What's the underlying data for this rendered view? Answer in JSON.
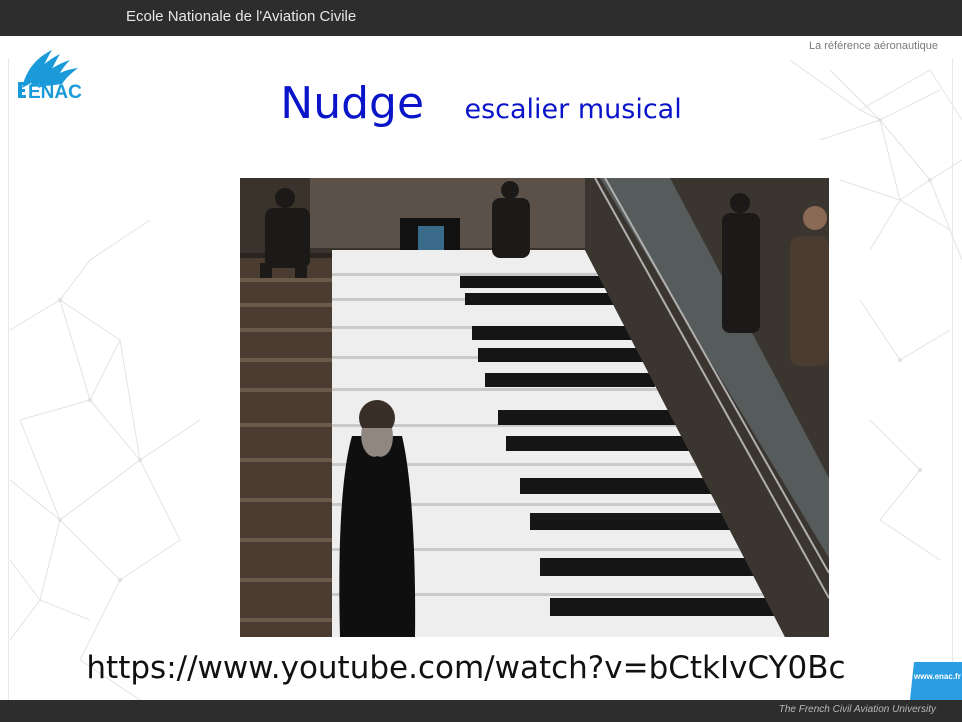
{
  "header": {
    "title": "Ecole Nationale de l'Aviation Civile",
    "tagline": "La référence aéronautique"
  },
  "logo": {
    "text": "ENAC",
    "icon": "enac-feather-logo"
  },
  "slide": {
    "title": "Nudge",
    "subtitle": "escalier musical",
    "url": "https://www.youtube.com/watch?v=bCtkIvCY0Bc",
    "video_icon": "piano-staircase-video-frame"
  },
  "footer": {
    "text": "The French Civil Aviation University",
    "badge": "www.enac.fr"
  },
  "colors": {
    "title": "#0a14c8",
    "header_bg": "#2d2d2d",
    "badge_bg": "#2a9de3"
  }
}
